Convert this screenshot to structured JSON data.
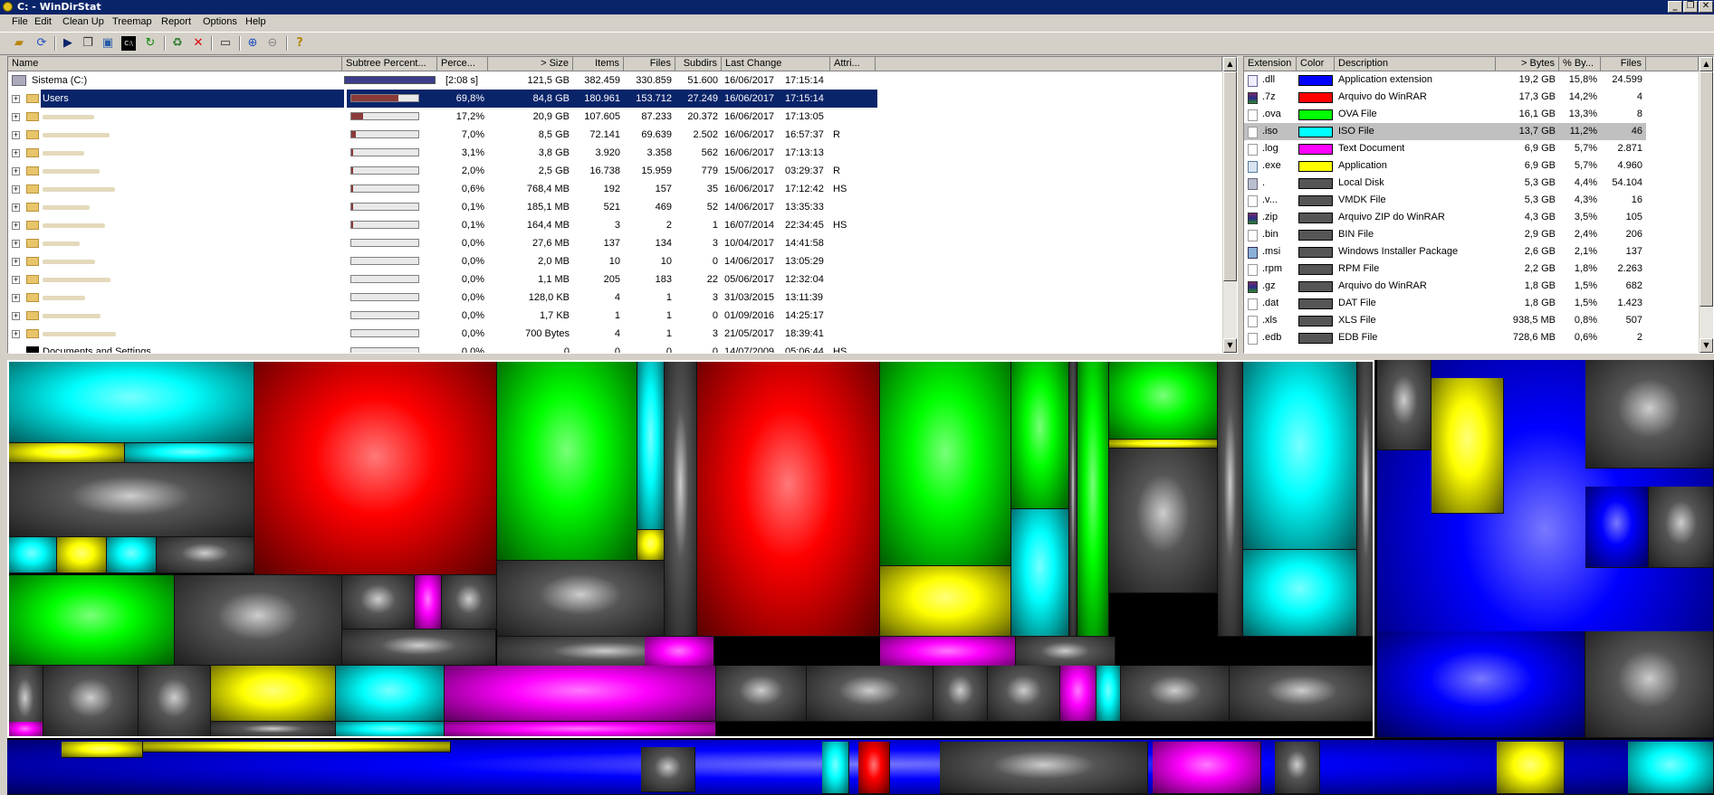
{
  "window": {
    "title": "C: - WinDirStat",
    "controls": [
      "_",
      "❐",
      "✕"
    ]
  },
  "menu": [
    "File",
    "Edit",
    "Clean Up",
    "Treemap",
    "Report",
    "Options",
    "Help"
  ],
  "toolbar": [
    "open-icon",
    "refresh-icon",
    "play-icon",
    "copy-icon",
    "explorer-icon",
    "cmd-icon",
    "refresh-selected-icon",
    "recycle-icon",
    "delete-icon",
    "new-folder-icon",
    "zoom-in-icon",
    "zoom-out-icon",
    "help-icon"
  ],
  "dirtree": {
    "headers": [
      "Name",
      "Subtree Percent...",
      "Perce...",
      "> Size",
      "Items",
      "Files",
      "Subdirs",
      "Last Change",
      "Attri..."
    ],
    "root": {
      "name": "Sistema (C:)",
      "pct_text": "[2:08 s]",
      "size": "121,5 GB",
      "items": "382.459",
      "files": "330.859",
      "subdirs": "51.600",
      "date": "16/06/2017",
      "time": "17:15:14",
      "attr": ""
    },
    "rows": [
      {
        "name": "Users",
        "pct": "69,8%",
        "fill": 0.698,
        "size": "84,8 GB",
        "items": "180.961",
        "files": "153.712",
        "subdirs": "27.249",
        "date": "16/06/2017",
        "time": "17:15:14",
        "attr": "",
        "selected": true
      },
      {
        "name": "",
        "pct": "17,2%",
        "fill": 0.172,
        "size": "20,9 GB",
        "items": "107.605",
        "files": "87.233",
        "subdirs": "20.372",
        "date": "16/06/2017",
        "time": "17:13:05",
        "attr": ""
      },
      {
        "name": "",
        "pct": "7,0%",
        "fill": 0.07,
        "size": "8,5 GB",
        "items": "72.141",
        "files": "69.639",
        "subdirs": "2.502",
        "date": "16/06/2017",
        "time": "16:57:37",
        "attr": "R"
      },
      {
        "name": "",
        "pct": "3,1%",
        "fill": 0.031,
        "size": "3,8 GB",
        "items": "3.920",
        "files": "3.358",
        "subdirs": "562",
        "date": "16/06/2017",
        "time": "17:13:13",
        "attr": ""
      },
      {
        "name": "",
        "pct": "2,0%",
        "fill": 0.02,
        "size": "2,5 GB",
        "items": "16.738",
        "files": "15.959",
        "subdirs": "779",
        "date": "15/06/2017",
        "time": "03:29:37",
        "attr": "R"
      },
      {
        "name": "",
        "pct": "0,6%",
        "fill": 0.006,
        "size": "768,4 MB",
        "items": "192",
        "files": "157",
        "subdirs": "35",
        "date": "16/06/2017",
        "time": "17:12:42",
        "attr": "HS"
      },
      {
        "name": "",
        "pct": "0,1%",
        "fill": 0.001,
        "size": "185,1 MB",
        "items": "521",
        "files": "469",
        "subdirs": "52",
        "date": "14/06/2017",
        "time": "13:35:33",
        "attr": ""
      },
      {
        "name": "",
        "pct": "0,1%",
        "fill": 0.001,
        "size": "164,4 MB",
        "items": "3",
        "files": "2",
        "subdirs": "1",
        "date": "16/07/2014",
        "time": "22:34:45",
        "attr": "HS"
      },
      {
        "name": "",
        "pct": "0,0%",
        "fill": 0,
        "size": "27,6 MB",
        "items": "137",
        "files": "134",
        "subdirs": "3",
        "date": "10/04/2017",
        "time": "14:41:58",
        "attr": ""
      },
      {
        "name": "",
        "pct": "0,0%",
        "fill": 0,
        "size": "2,0 MB",
        "items": "10",
        "files": "10",
        "subdirs": "0",
        "date": "14/06/2017",
        "time": "13:05:29",
        "attr": ""
      },
      {
        "name": "",
        "pct": "0,0%",
        "fill": 0,
        "size": "1,1 MB",
        "items": "205",
        "files": "183",
        "subdirs": "22",
        "date": "05/06/2017",
        "time": "12:32:04",
        "attr": ""
      },
      {
        "name": "",
        "pct": "0,0%",
        "fill": 0,
        "size": "128,0 KB",
        "items": "4",
        "files": "1",
        "subdirs": "3",
        "date": "31/03/2015",
        "time": "13:11:39",
        "attr": ""
      },
      {
        "name": "",
        "pct": "0,0%",
        "fill": 0,
        "size": "1,7 KB",
        "items": "1",
        "files": "1",
        "subdirs": "0",
        "date": "01/09/2016",
        "time": "14:25:17",
        "attr": ""
      },
      {
        "name": "",
        "pct": "0,0%",
        "fill": 0,
        "size": "700 Bytes",
        "items": "4",
        "files": "1",
        "subdirs": "3",
        "date": "21/05/2017",
        "time": "18:39:41",
        "attr": ""
      },
      {
        "name": "Documents and Settings",
        "pct": "0,0%",
        "fill": 0,
        "size": "0",
        "items": "0",
        "files": "0",
        "subdirs": "0",
        "date": "14/07/2009",
        "time": "05:06:44",
        "attr": "HS"
      }
    ]
  },
  "extlist": {
    "headers": [
      "Extension",
      "Color",
      "Description",
      "> Bytes",
      "% By...",
      "Files"
    ],
    "rows": [
      {
        "ext": ".dll",
        "color": "#0000ff",
        "desc": "Application extension",
        "bytes": "19,2 GB",
        "pct": "15,8%",
        "files": "24.599",
        "icon": "dll"
      },
      {
        "ext": ".7z",
        "color": "#ff0000",
        "desc": "Arquivo do WinRAR",
        "bytes": "17,3 GB",
        "pct": "14,2%",
        "files": "4",
        "icon": "rar"
      },
      {
        "ext": ".ova",
        "color": "#00ff00",
        "desc": "OVA File",
        "bytes": "16,1 GB",
        "pct": "13,3%",
        "files": "8",
        "icon": "file"
      },
      {
        "ext": ".iso",
        "color": "#00ffff",
        "desc": "ISO File",
        "bytes": "13,7 GB",
        "pct": "11,2%",
        "files": "46",
        "icon": "file",
        "selected": true
      },
      {
        "ext": ".log",
        "color": "#ff00ff",
        "desc": "Text Document",
        "bytes": "6,9 GB",
        "pct": "5,7%",
        "files": "2.871",
        "icon": "file"
      },
      {
        "ext": ".exe",
        "color": "#ffff00",
        "desc": "Application",
        "bytes": "6,9 GB",
        "pct": "5,7%",
        "files": "4.960",
        "icon": "exe"
      },
      {
        "ext": ".",
        "color": "#555555",
        "desc": "Local Disk",
        "bytes": "5,3 GB",
        "pct": "4,4%",
        "files": "54.104",
        "icon": "disk"
      },
      {
        "ext": ".v...",
        "color": "#555555",
        "desc": "VMDK File",
        "bytes": "5,3 GB",
        "pct": "4,3%",
        "files": "16",
        "icon": "file"
      },
      {
        "ext": ".zip",
        "color": "#555555",
        "desc": "Arquivo ZIP do WinRAR",
        "bytes": "4,3 GB",
        "pct": "3,5%",
        "files": "105",
        "icon": "rar"
      },
      {
        "ext": ".bin",
        "color": "#555555",
        "desc": "BIN File",
        "bytes": "2,9 GB",
        "pct": "2,4%",
        "files": "206",
        "icon": "file"
      },
      {
        "ext": ".msi",
        "color": "#555555",
        "desc": "Windows Installer Package",
        "bytes": "2,6 GB",
        "pct": "2,1%",
        "files": "137",
        "icon": "msi"
      },
      {
        "ext": ".rpm",
        "color": "#555555",
        "desc": "RPM File",
        "bytes": "2,2 GB",
        "pct": "1,8%",
        "files": "2.263",
        "icon": "file"
      },
      {
        "ext": ".gz",
        "color": "#555555",
        "desc": "Arquivo do WinRAR",
        "bytes": "1,8 GB",
        "pct": "1,5%",
        "files": "682",
        "icon": "rar"
      },
      {
        "ext": ".dat",
        "color": "#555555",
        "desc": "DAT File",
        "bytes": "1,8 GB",
        "pct": "1,5%",
        "files": "1.423",
        "icon": "file"
      },
      {
        "ext": ".xls",
        "color": "#555555",
        "desc": "XLS File",
        "bytes": "938,5 MB",
        "pct": "0,8%",
        "files": "507",
        "icon": "file"
      },
      {
        "ext": ".edb",
        "color": "#555555",
        "desc": "EDB File",
        "bytes": "728,6 MB",
        "pct": "0,6%",
        "files": "2",
        "icon": "file"
      }
    ]
  },
  "treemap": {
    "palette": {
      "dll": "#0000ff",
      "7z": "#ff0000",
      "ova": "#00ff00",
      "iso": "#00ffff",
      "log": "#ff00ff",
      "exe": "#ffff00",
      "other": "#555555"
    }
  }
}
